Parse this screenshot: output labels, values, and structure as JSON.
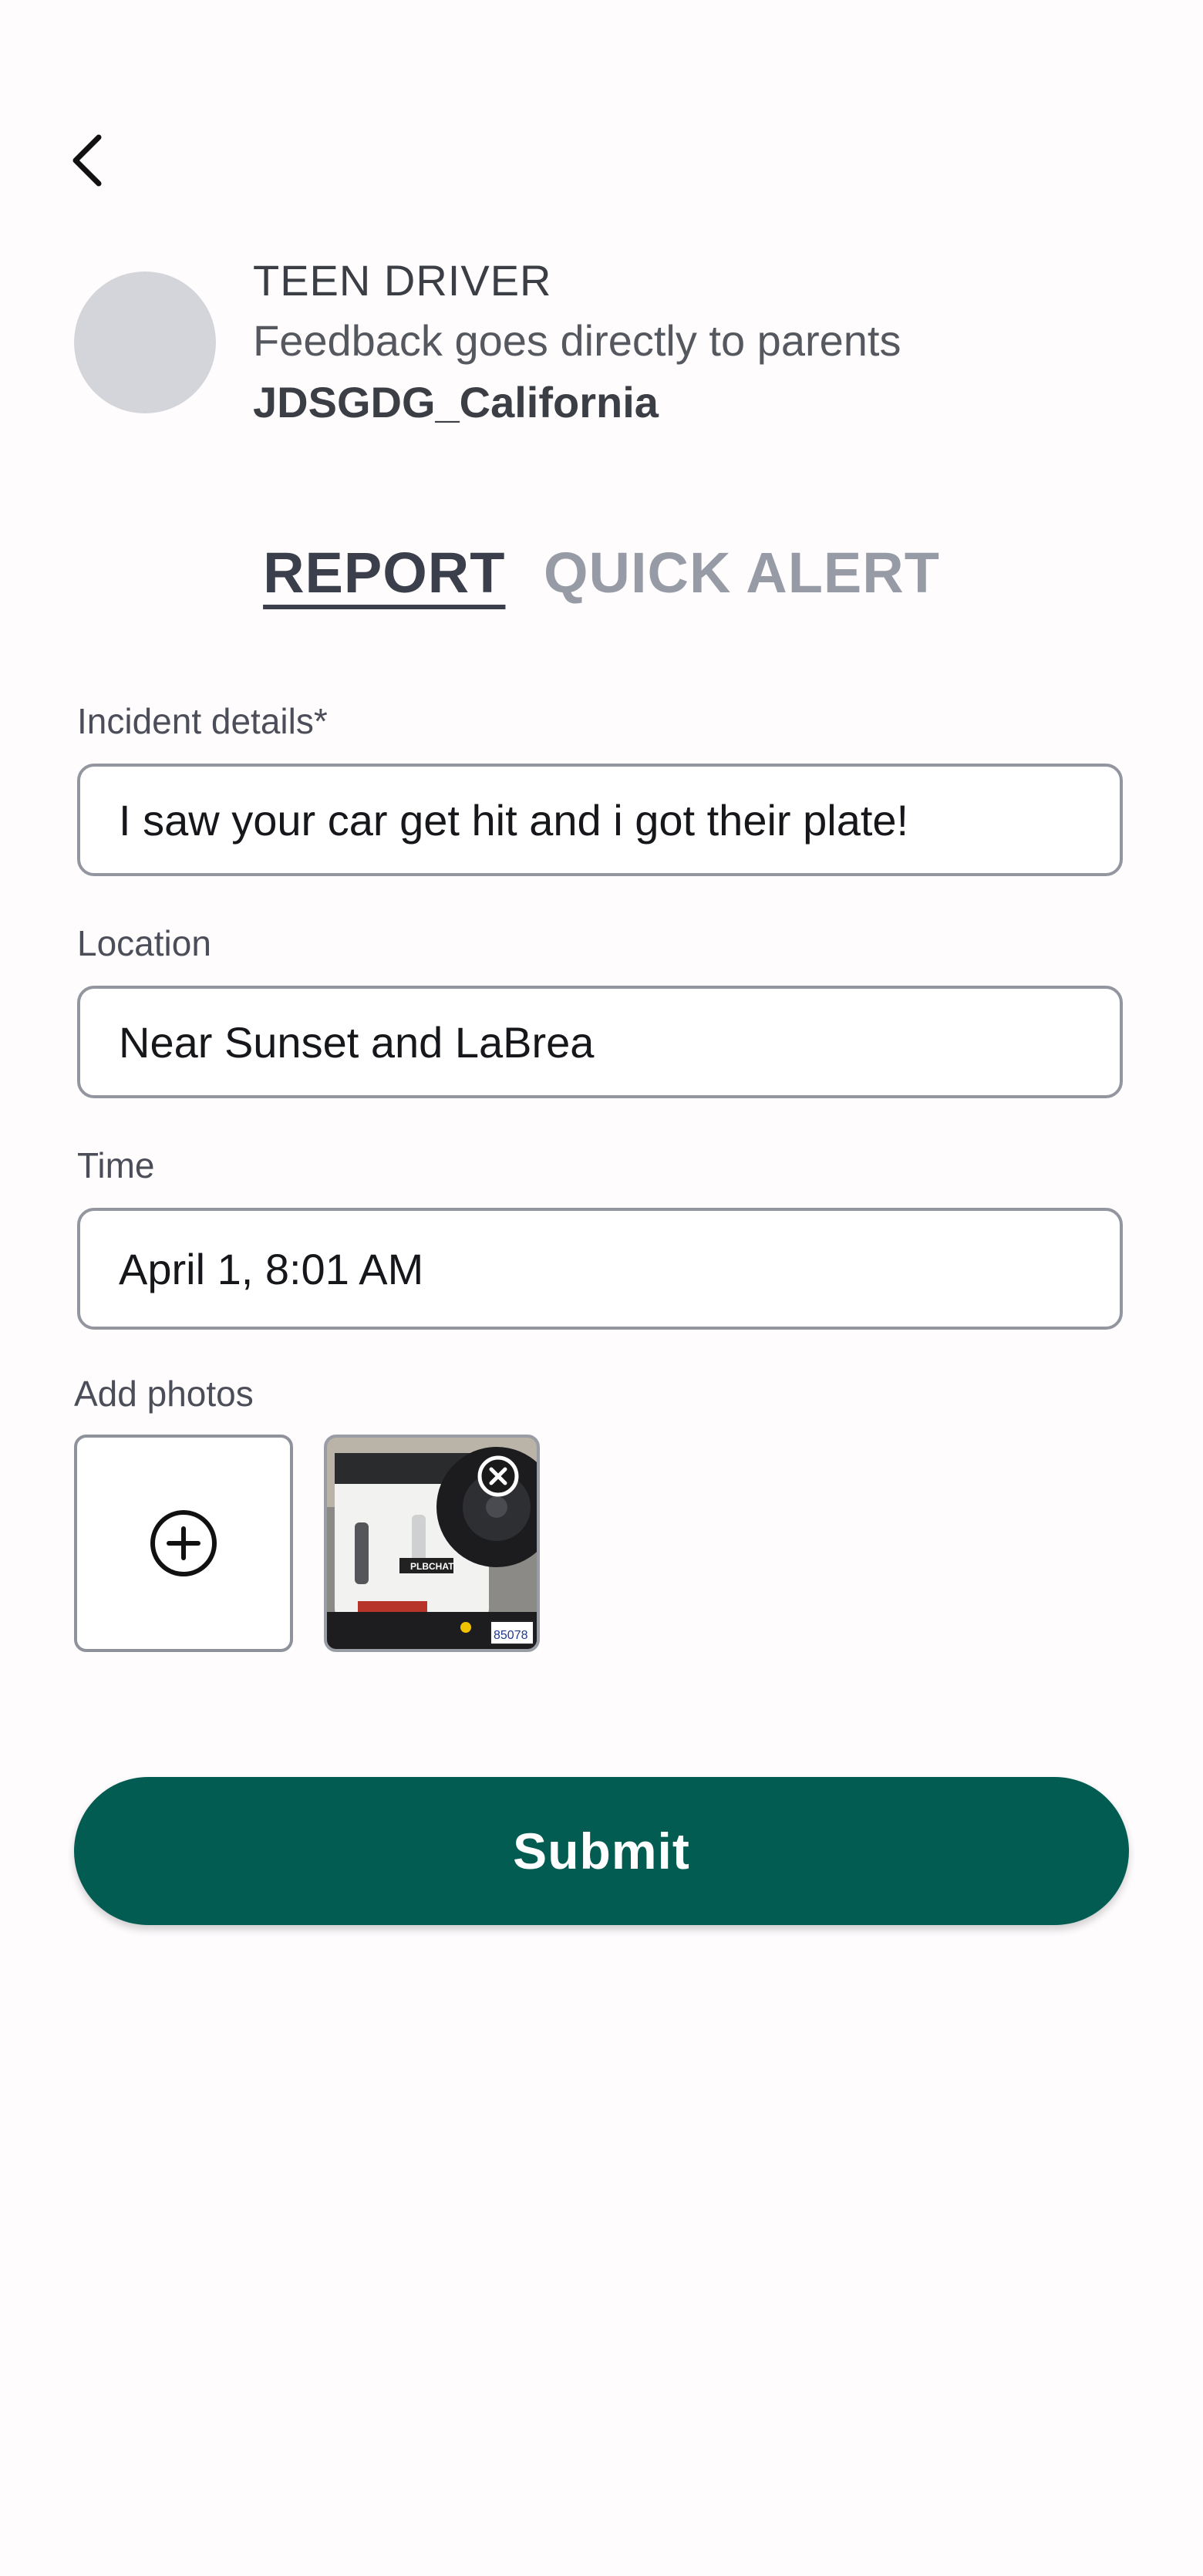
{
  "header": {
    "back_icon": "chevron-left-icon"
  },
  "profile": {
    "role": "TEEN DRIVER",
    "subtitle": "Feedback goes directly to parents",
    "plate_name": "JDSGDG_California"
  },
  "tabs": [
    {
      "label": "REPORT",
      "active": true
    },
    {
      "label": "QUICK ALERT",
      "active": false
    }
  ],
  "form": {
    "incident": {
      "label": "Incident details*",
      "value": "I saw your car get hit and i got their plate!"
    },
    "location": {
      "label": "Location",
      "value": "Near Sunset and LaBrea"
    },
    "time": {
      "label": "Time",
      "value": "April 1, 8:01 AM"
    },
    "photos": {
      "label": "Add photos",
      "add_icon": "plus-circle-icon",
      "remove_icon": "close-circle-icon",
      "thumbnail": {
        "sticker_text": "PLBCHAT",
        "plate_text": "85078"
      }
    }
  },
  "actions": {
    "submit_label": "Submit"
  },
  "colors": {
    "primary": "#035c52",
    "tab_active": "#3a3f4b",
    "tab_inactive": "#979ba6",
    "avatar": "#d4d5da"
  }
}
